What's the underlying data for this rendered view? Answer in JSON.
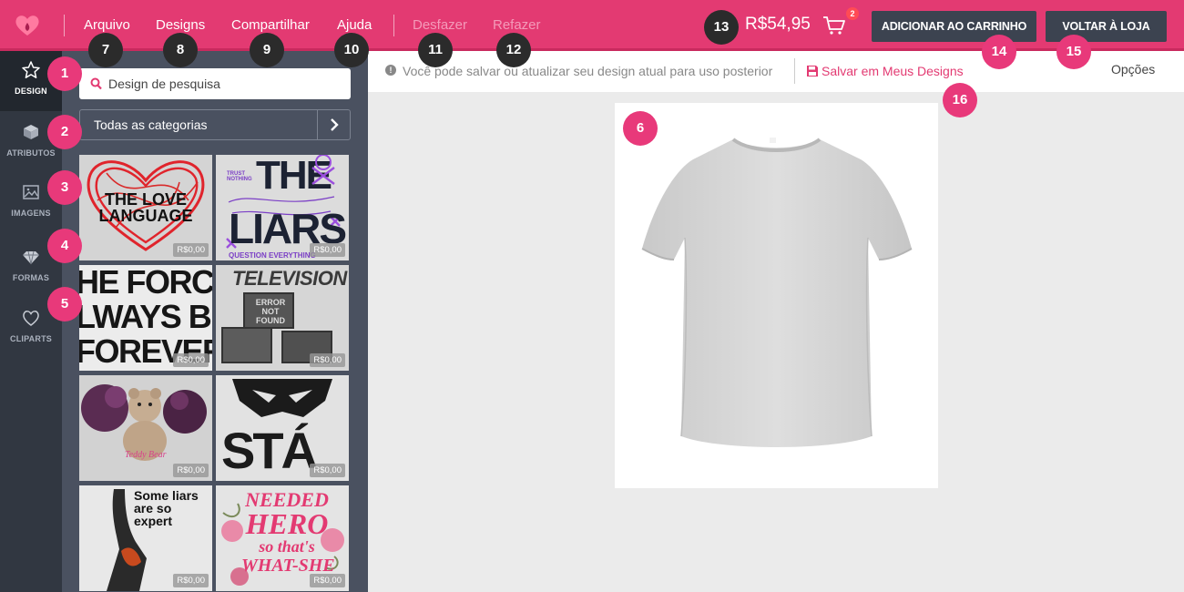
{
  "brand_color": "#e33a72",
  "topbar": {
    "logo_icon": "heart-logo-icon",
    "menu": {
      "arquivo": "Arquivo",
      "designs": "Designs",
      "compartilhar": "Compartilhar",
      "ajuda": "Ajuda",
      "desfazer": "Desfazer",
      "refazer": "Refazer"
    },
    "price": "R$54,95",
    "cart_icon": "cart-icon",
    "cart_count": "2",
    "add_to_cart": "ADICIONAR AO CARRINHO",
    "back_to_store": "VOLTAR À LOJA"
  },
  "sidebar": {
    "items": [
      {
        "label": "DESIGN",
        "icon": "star-icon"
      },
      {
        "label": "ATRIBUTOS",
        "icon": "cube-icon"
      },
      {
        "label": "IMAGENS",
        "icon": "image-icon"
      },
      {
        "label": "FORMAS",
        "icon": "diamond-icon"
      },
      {
        "label": "CLIPARTS",
        "icon": "heart-icon"
      }
    ]
  },
  "panel": {
    "search_value": "Design de pesquisa",
    "category": "Todas as categorias",
    "thumbs": [
      {
        "price": "R$0,00",
        "text": "THE LOVE LANGUAGE"
      },
      {
        "price": "R$0,00",
        "text_top": "THE",
        "text_bottom": "LIARS",
        "text_small": "TRUST NOTHING",
        "text_foot": "QUESTION EVERYTHING"
      },
      {
        "price": "R$0,00",
        "lines": [
          "HE FORCE",
          "LWAYS BE",
          "FOREVER"
        ]
      },
      {
        "price": "R$0,00",
        "text": "TELEVISION",
        "text_error": "ERROR NOT FOUND"
      },
      {
        "price": "R$0,00",
        "text": "Teddy Bear"
      },
      {
        "price": "R$0,00",
        "text": "STÁ"
      },
      {
        "price": "R$0,00",
        "text": "Some liars are so expert"
      },
      {
        "price": "R$0,00",
        "lines": [
          "NEEDED",
          "HERO",
          "so that's",
          "WHAT-SHE"
        ]
      }
    ]
  },
  "infobar": {
    "message": "Você pode salvar ou atualizar seu design atual para uso posterior",
    "save_label": "Salvar em Meus Designs",
    "options": "Opções"
  },
  "badges": [
    "1",
    "2",
    "3",
    "4",
    "5",
    "6",
    "7",
    "8",
    "9",
    "10",
    "11",
    "12",
    "13",
    "14",
    "15",
    "16"
  ]
}
